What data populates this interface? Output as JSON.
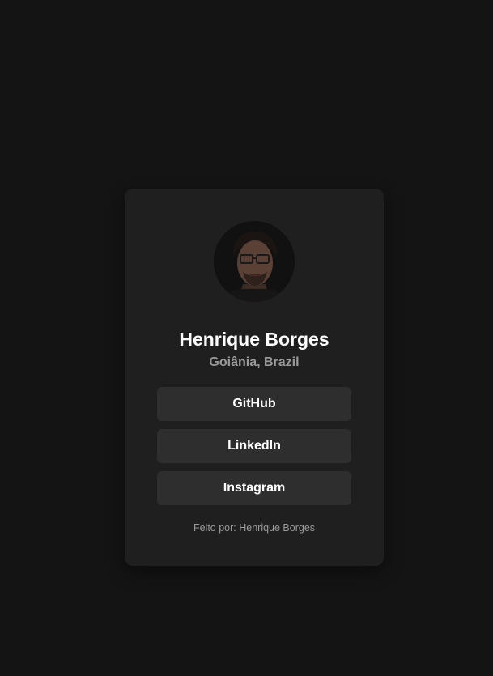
{
  "profile": {
    "name": "Henrique Borges",
    "location": "Goiânia, Brazil"
  },
  "links": [
    {
      "label": "GitHub"
    },
    {
      "label": "LinkedIn"
    },
    {
      "label": "Instagram"
    }
  ],
  "footer": {
    "text": "Feito por: Henrique Borges"
  },
  "colors": {
    "background": "#141414",
    "card": "#1f1f1f",
    "button": "#2e2e2e",
    "text_primary": "#ffffff",
    "text_secondary": "#9a9a9a"
  }
}
